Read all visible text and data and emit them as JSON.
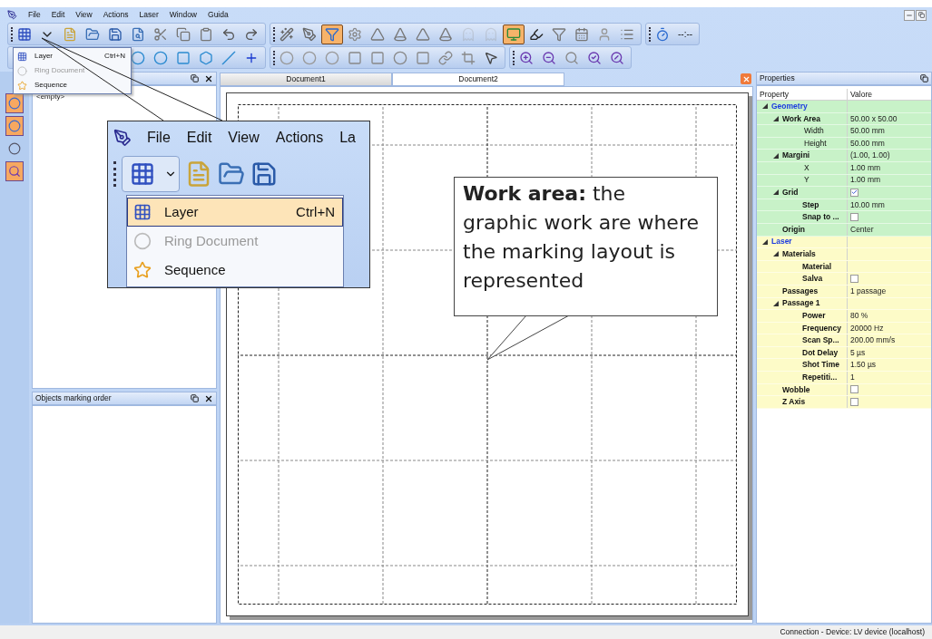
{
  "menu": [
    "File",
    "Edit",
    "View",
    "Actions",
    "Laser",
    "Window",
    "Guida"
  ],
  "laser_toolbar": {
    "buttons": [
      {
        "pressed": false,
        "disabled": false
      },
      {
        "pressed": false,
        "disabled": false
      },
      {
        "pressed": true,
        "disabled": false
      },
      {
        "pressed": false,
        "disabled": false
      },
      {
        "pressed": false,
        "disabled": false
      },
      {
        "pressed": false,
        "disabled": false
      },
      {
        "pressed": false,
        "disabled": false
      },
      {
        "pressed": false,
        "disabled": false
      },
      {
        "pressed": false,
        "disabled": true
      },
      {
        "pressed": false,
        "disabled": true
      },
      {
        "pressed": true,
        "disabled": false
      },
      {
        "pressed": false,
        "disabled": false
      },
      {
        "pressed": false,
        "disabled": false
      },
      {
        "pressed": false,
        "disabled": false
      },
      {
        "pressed": false,
        "disabled": false
      },
      {
        "pressed": false,
        "disabled": false
      }
    ]
  },
  "timer": "--:--",
  "dropdown": [
    {
      "label": "Layer",
      "shortcut": "Ctrl+N",
      "disabled": false,
      "highlighted": false
    },
    {
      "label": "Ring Document",
      "disabled": true,
      "highlighted": false
    },
    {
      "label": "Sequence",
      "disabled": false,
      "highlighted": false
    }
  ],
  "side_tools": [
    {
      "pressed": true
    },
    {
      "pressed": true
    },
    {
      "pressed": false
    },
    {
      "pressed": true
    }
  ],
  "left_panel": {
    "content": "<empty>"
  },
  "order_panel": {
    "title": "Objects marking order"
  },
  "document_tabs": [
    {
      "label": "Document1",
      "selected": false
    },
    {
      "label": "Document2",
      "selected": true
    }
  ],
  "zoom_inset": {
    "menu": [
      "File",
      "Edit",
      "View",
      "Actions",
      "La"
    ],
    "dropdown": [
      {
        "label": "Layer",
        "shortcut": "Ctrl+N",
        "disabled": false,
        "highlighted": true
      },
      {
        "label": "Ring Document",
        "disabled": true,
        "highlighted": false
      },
      {
        "label": "Sequence",
        "disabled": false,
        "highlighted": false
      }
    ]
  },
  "callout": "**Work area:** the graphic work are where the marking layout is represented",
  "properties": {
    "title": "Properties",
    "columns": [
      "Property",
      "Valore"
    ],
    "rows": [
      {
        "name": "Geometry",
        "bold": true,
        "color": "#c8f2c8",
        "expanded": true,
        "children": [
          {
            "name": "Work Area",
            "bold": true,
            "value": "50.00 x 50.00",
            "expanded": true,
            "children": [
              {
                "name": "Width",
                "bold": false,
                "value": "50.00 mm"
              },
              {
                "name": "Height",
                "bold": false,
                "value": "50.00 mm"
              }
            ]
          },
          {
            "name": "Margini",
            "bold": true,
            "value": "(1.00, 1.00)",
            "expanded": true,
            "children": [
              {
                "name": "X",
                "bold": false,
                "value": "1.00 mm"
              },
              {
                "name": "Y",
                "bold": false,
                "value": "1.00 mm"
              }
            ]
          },
          {
            "name": "Grid",
            "bold": true,
            "kind": "check",
            "checked": true,
            "expanded": true,
            "children": [
              {
                "name": "Step",
                "bold": true,
                "value": "10.00 mm"
              },
              {
                "name": "Snap to ...",
                "bold": true,
                "kind": "check",
                "checked": false
              }
            ]
          },
          {
            "name": "Origin",
            "bold": true,
            "value": "Center"
          }
        ]
      },
      {
        "name": "Laser",
        "bold": true,
        "color": "#fdfbc8",
        "expanded": true,
        "children": [
          {
            "name": "Materials",
            "bold": true,
            "expanded": true,
            "children": [
              {
                "name": "Material",
                "bold": true
              },
              {
                "name": "Salva",
                "bold": true,
                "kind": "check",
                "checked": false
              }
            ]
          },
          {
            "name": "Passages",
            "bold": true,
            "value": "1 passage"
          },
          {
            "name": "Passage 1",
            "bold": true,
            "expanded": true,
            "children": [
              {
                "name": "Power",
                "bold": true,
                "value": "80 %"
              },
              {
                "name": "Frequency",
                "bold": true,
                "value": "20000 Hz"
              },
              {
                "name": "Scan Sp...",
                "bold": true,
                "value": "200.00 mm/s"
              },
              {
                "name": "Dot Delay",
                "bold": true,
                "value": "5 µs"
              },
              {
                "name": "Shot Time",
                "bold": true,
                "value": "1.50 µs"
              },
              {
                "name": "Repetiti...",
                "bold": true,
                "value": "1"
              }
            ]
          },
          {
            "name": "Wobble",
            "bold": true,
            "kind": "check",
            "checked": false
          },
          {
            "name": "Z Axis",
            "bold": true,
            "kind": "check",
            "checked": false
          }
        ]
      }
    ]
  },
  "status_bar": "Connection - Device: LV device (localhost)"
}
